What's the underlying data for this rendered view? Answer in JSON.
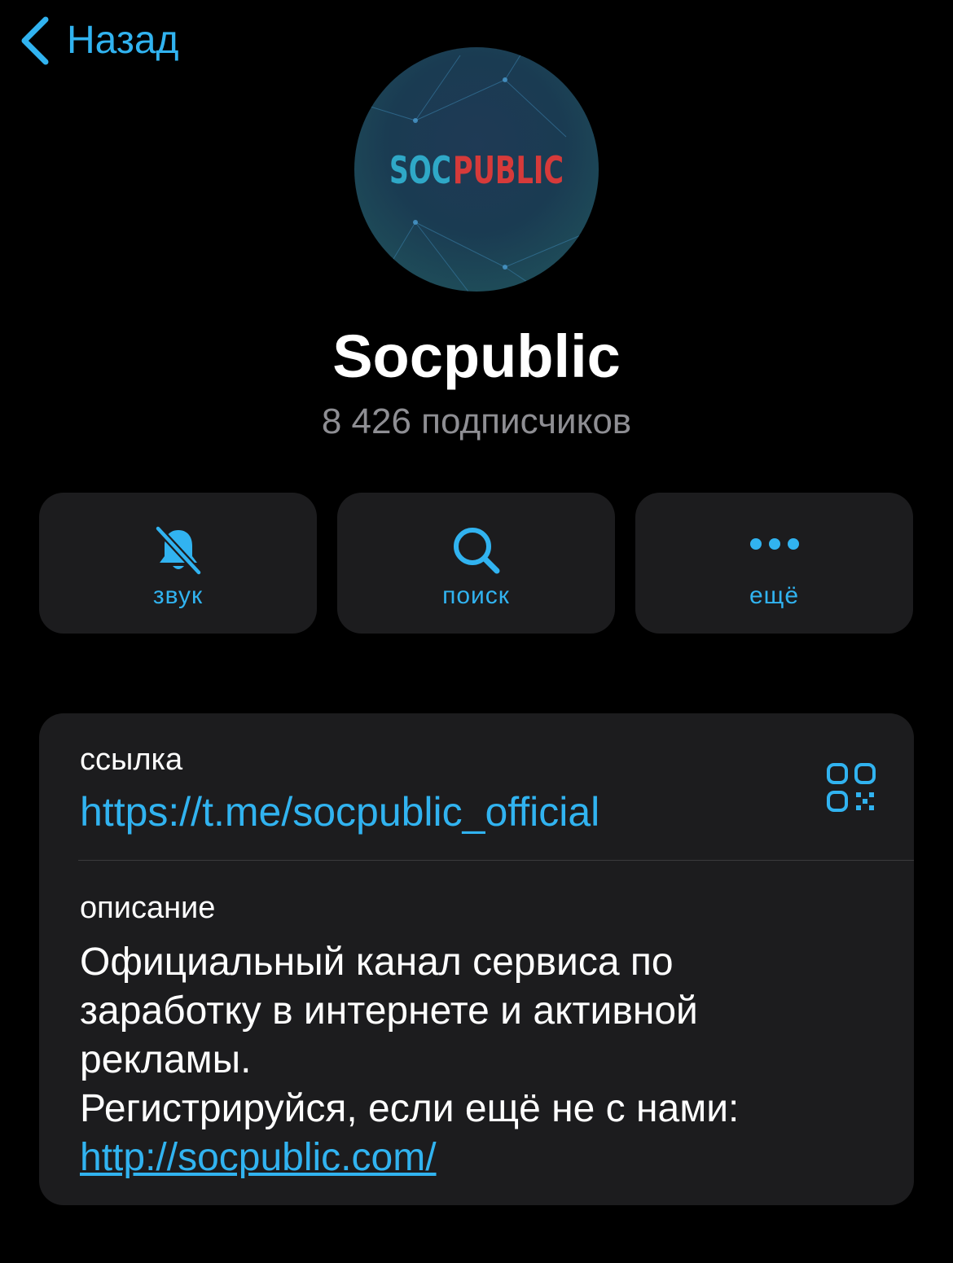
{
  "nav": {
    "back_label": "Назад",
    "back_icon": "chevron-left-icon"
  },
  "channel": {
    "avatar_text_left": "SOC",
    "avatar_text_right": "PUBLIC",
    "name": "Socpublic",
    "subscribers": "8 426 подписчиков"
  },
  "actions": [
    {
      "label": "звук",
      "icon": "bell-slash-icon"
    },
    {
      "label": "поиск",
      "icon": "search-icon"
    },
    {
      "label": "ещё",
      "icon": "more-dots-icon"
    }
  ],
  "info": {
    "link_label": "ссылка",
    "link_value": "https://t.me/socpublic_official",
    "qr_icon": "qr-code-icon",
    "description_label": "описание",
    "description_lines": [
      "Официальный канал сервиса по",
      "заработку в интернете и активной",
      "рекламы.",
      "Регистрируйся, если ещё не с нами:"
    ],
    "description_link": "http://socpublic.com/"
  },
  "colors": {
    "accent": "#31b3f0",
    "background": "#000000",
    "card": "#1c1c1e",
    "secondary_text": "#8e8e93",
    "avatar_red": "#d63a3a",
    "avatar_teal": "#2fa8c7"
  }
}
